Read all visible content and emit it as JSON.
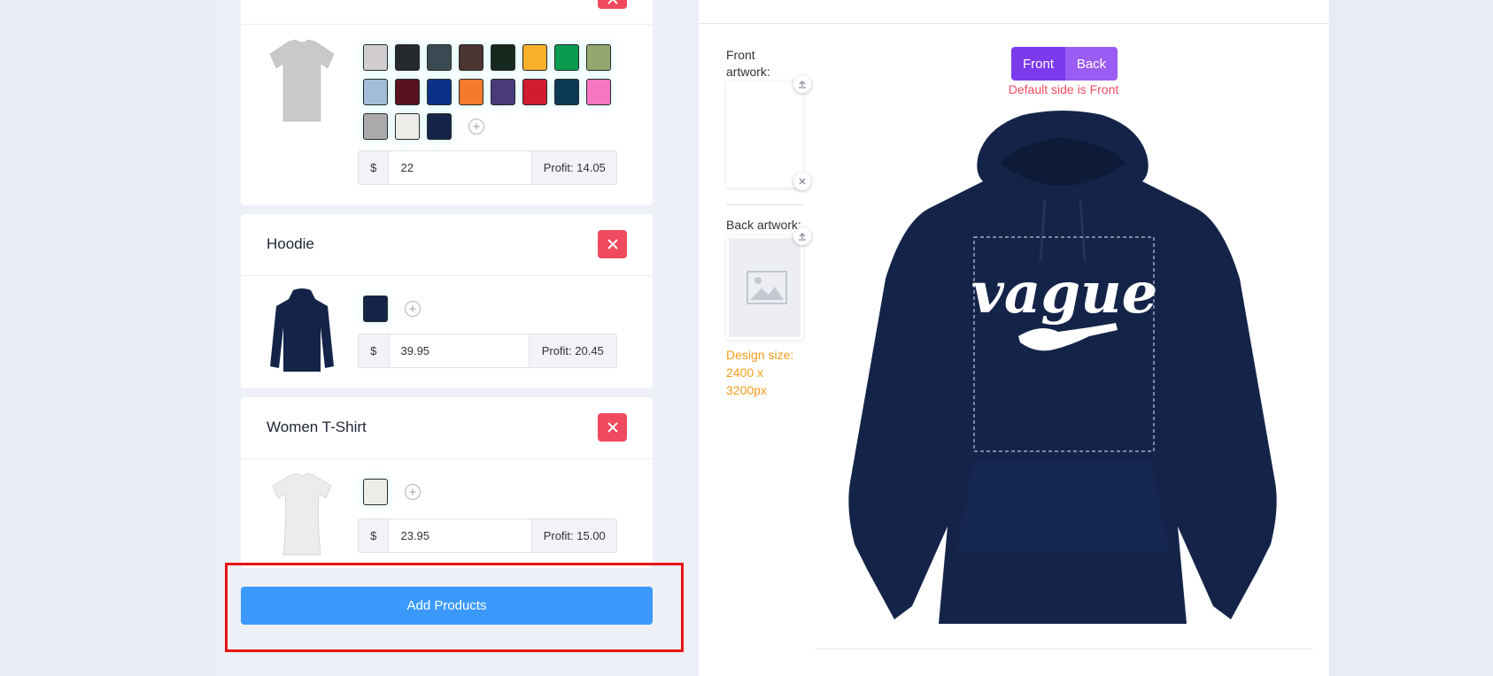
{
  "products": [
    {
      "name": "",
      "swatches": [
        "#d2ced0",
        "#26292c",
        "#3a4a52",
        "#4a3530",
        "#16291f",
        "#f8b02a",
        "#099a4f",
        "#93a770",
        "#a3bcd8",
        "#5a1220",
        "#0c3288",
        "#f67a2a",
        "#4a3a7a",
        "#d11b2e",
        "#0c3a56",
        "#f877c3",
        "#acaaac",
        "#eeece9",
        "#142449"
      ],
      "currency": "$",
      "price": "22",
      "profit": "Profit: 14.05",
      "garment_color": "#c9c9c9"
    },
    {
      "name": "Hoodie",
      "swatches": [
        "#142449"
      ],
      "currency": "$",
      "price": "39.95",
      "profit": "Profit: 20.45",
      "garment_color": "#142449"
    },
    {
      "name": "Women T-Shirt",
      "swatches": [
        "#eeece9"
      ],
      "currency": "$",
      "price": "23.95",
      "profit": "Profit: 15.00",
      "garment_color": "#ececec"
    }
  ],
  "actions": {
    "add_products": "Add Products",
    "remove_icon": "close-icon",
    "add_color_icon": "plus-circle-icon"
  },
  "artwork": {
    "front_label": "Front artwork:",
    "back_label": "Back artwork:",
    "design_size": "Design size: 2400 x 3200px",
    "upload_icon": "upload-icon",
    "remove_icon": "close-icon",
    "placeholder_icon": "image-icon"
  },
  "preview": {
    "side_buttons": [
      "Front",
      "Back"
    ],
    "active_side": "Front",
    "default_note": "Default side is Front",
    "garment_color": "#142449",
    "design_text": "vague"
  },
  "colors": {
    "accent": "#7c3aed",
    "danger": "#f04a5e",
    "primary": "#3a99fb",
    "warning": "#f59b1a"
  }
}
